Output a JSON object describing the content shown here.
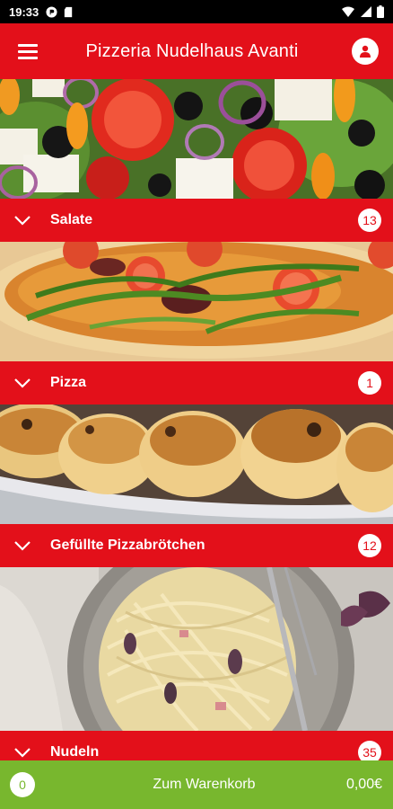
{
  "status_bar": {
    "time": "19:33"
  },
  "app_bar": {
    "title": "Pizzeria Nudelhaus Avanti"
  },
  "categories": [
    {
      "name": "Salate",
      "count": "13",
      "image": "salad-photo"
    },
    {
      "name": "Pizza",
      "count": "1",
      "image": "pizza-photo"
    },
    {
      "name": "Gefüllte Pizzabrötchen",
      "count": "12",
      "image": "pizza-rolls-photo"
    },
    {
      "name": "Nudeln",
      "count": "35",
      "image": "pasta-photo"
    }
  ],
  "cart": {
    "count": "0",
    "label": "Zum Warenkorb",
    "total": "0,00€"
  },
  "colors": {
    "brand_red": "#e3101a",
    "cart_green": "#78b72e"
  }
}
